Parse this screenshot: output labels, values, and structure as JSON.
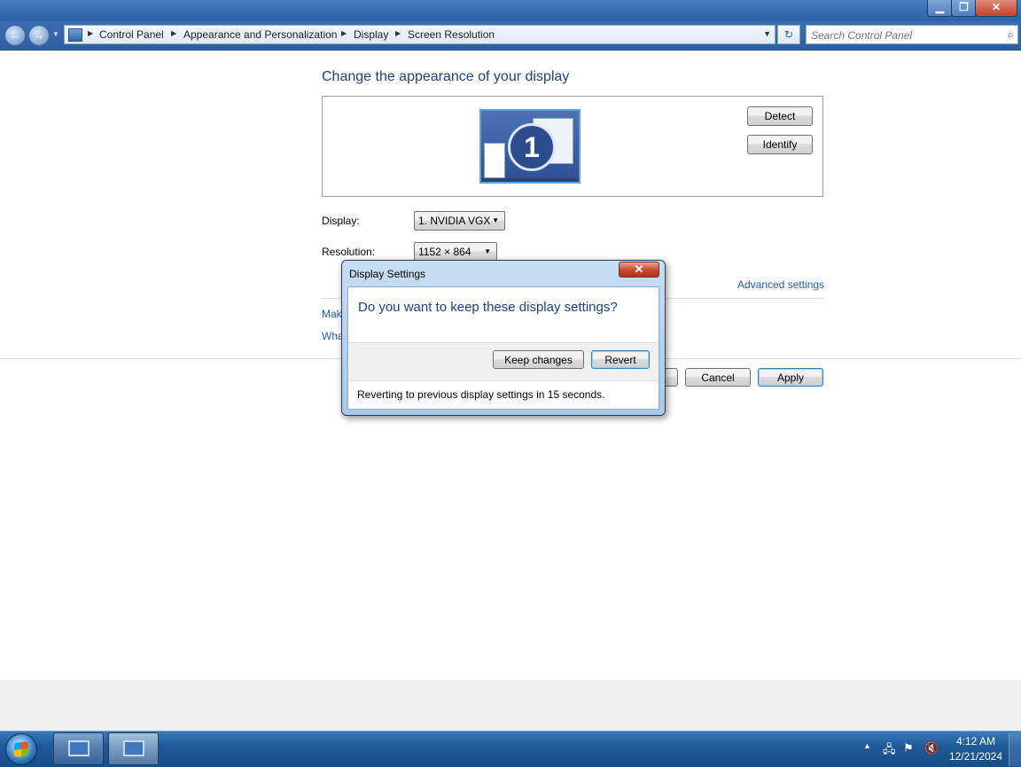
{
  "window": {
    "minimize_glyph": "▁",
    "maximize_glyph": "❐",
    "close_glyph": "✕"
  },
  "nav": {
    "back_glyph": "←",
    "forward_glyph": "→",
    "recent_glyph": "▼",
    "breadcrumb": [
      "Control Panel",
      "Appearance and Personalization",
      "Display",
      "Screen Resolution"
    ],
    "refresh_glyph": "↻",
    "search_placeholder": "Search Control Panel",
    "icons": {
      "back": "back-arrow-icon",
      "forward": "forward-arrow-icon",
      "control_panel": "control-panel-icon",
      "search": "magnifier-icon"
    }
  },
  "content": {
    "title": "Change the appearance of your display",
    "monitor_number": "1",
    "detect_label": "Detect",
    "identify_label": "Identify",
    "display_label": "Display:",
    "display_value": "1. NVIDIA VGX",
    "resolution_label": "Resolution:",
    "resolution_value": "1152 × 864",
    "advanced_link": "Advanced settings",
    "link_make_partial": "Mak",
    "link_what_partial": "Wha",
    "cancel_label": "Cancel",
    "apply_label": "Apply"
  },
  "dialog": {
    "title": "Display Settings",
    "question": "Do you want to keep these display settings?",
    "keep_label": "Keep changes",
    "revert_label": "Revert",
    "status": "Reverting to previous display settings in 15 seconds."
  },
  "taskbar": {
    "time": "4:12 AM",
    "date": "12/21/2024",
    "tray_arrow": "▲",
    "tray_network": "🖧",
    "tray_flag": "⚑",
    "tray_volume": "🔇"
  },
  "colors": {
    "title_text": "#1e3f8a",
    "link": "#1e5cb3",
    "taskbar": "#1f5a98"
  }
}
